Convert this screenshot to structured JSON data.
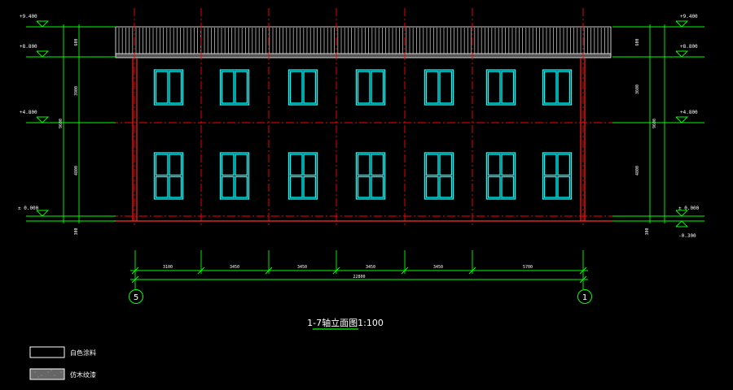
{
  "drawing": {
    "title": "1-7轴立面图1:100",
    "axis_labels": {
      "left": "5",
      "right": "1"
    },
    "elevations_left": [
      "+9.400",
      "+8.800",
      "+4.800",
      "± 0.000"
    ],
    "elevations_right": [
      "+9.400",
      "+8.800",
      "+4.800",
      "± 0.000",
      "-0.300"
    ],
    "vertical_dims_left": [
      "600",
      "3900",
      "9600",
      "4800",
      "300"
    ],
    "vertical_dims_right": [
      "600",
      "3600",
      "9600",
      "4800",
      "300"
    ],
    "horizontal_dims": [
      "3100",
      "3450",
      "3450",
      "3450",
      "3450",
      "5700"
    ],
    "horizontal_total": "22800"
  },
  "legend": [
    {
      "label": "白色涂料",
      "swatch": "plain"
    },
    {
      "label": "仿木纹漆",
      "swatch": "hatched"
    }
  ],
  "colors": {
    "background": "#000000",
    "outline": "#ff2020",
    "axis_line": "#ff0000",
    "dimension": "#00ff00",
    "window": "#00ffff",
    "roof": "#ffffff"
  }
}
